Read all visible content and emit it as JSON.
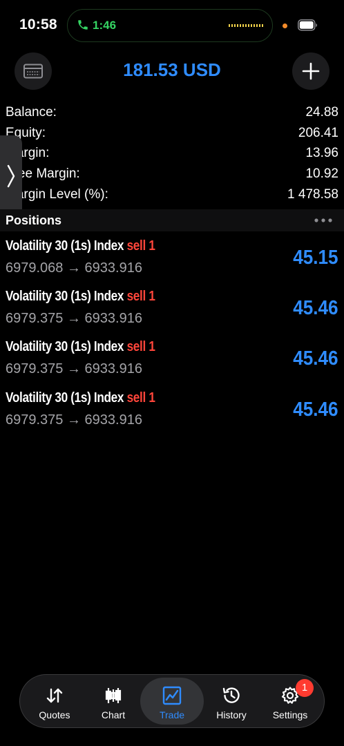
{
  "status_bar": {
    "time": "10:58",
    "call_timer": "1:46"
  },
  "header": {
    "account_value": "181.53 USD"
  },
  "summary": [
    {
      "label": "Balance:",
      "value": "24.88"
    },
    {
      "label": "Equity:",
      "value": "206.41"
    },
    {
      "label": "Margin:",
      "value": "13.96"
    },
    {
      "label": "Free Margin:",
      "value": "10.92"
    },
    {
      "label": "Margin Level (%):",
      "value": "1 478.58"
    }
  ],
  "positions": {
    "title": "Positions",
    "items": [
      {
        "symbol": "Volatility 30 (1s) Index",
        "side": "sell 1",
        "prices": "6979.068 → 6933.916",
        "profit": "45.15"
      },
      {
        "symbol": "Volatility 30 (1s) Index",
        "side": "sell 1",
        "prices": "6979.375 → 6933.916",
        "profit": "45.46"
      },
      {
        "symbol": "Volatility 30 (1s) Index",
        "side": "sell 1",
        "prices": "6979.375 → 6933.916",
        "profit": "45.46"
      },
      {
        "symbol": "Volatility 30 (1s) Index",
        "side": "sell 1",
        "prices": "6979.375 → 6933.916",
        "profit": "45.46"
      }
    ]
  },
  "tabs": [
    {
      "label": "Quotes",
      "icon": "quotes-icon"
    },
    {
      "label": "Chart",
      "icon": "chart-icon"
    },
    {
      "label": "Trade",
      "icon": "trade-icon",
      "active": true
    },
    {
      "label": "History",
      "icon": "history-icon"
    },
    {
      "label": "Settings",
      "icon": "settings-icon",
      "badge": "1"
    }
  ],
  "colors": {
    "accent": "#2f8cff",
    "sell": "#ff453a",
    "call_green": "#35d463",
    "badge": "#ff3b30"
  }
}
